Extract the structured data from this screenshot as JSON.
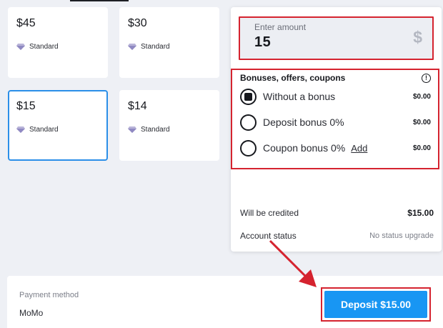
{
  "cards": [
    {
      "amount": "$45",
      "tier": "Standard",
      "selected": false
    },
    {
      "amount": "$30",
      "tier": "Standard",
      "selected": false
    },
    {
      "amount": "$15",
      "tier": "Standard",
      "selected": true
    },
    {
      "amount": "$14",
      "tier": "Standard",
      "selected": false
    }
  ],
  "amount_field": {
    "label": "Enter amount",
    "value": "15",
    "currency": "$"
  },
  "bonuses": {
    "title": "Bonuses, offers, coupons",
    "info": "!",
    "options": [
      {
        "label": "Without a bonus",
        "value": "$0.00",
        "selected": true
      },
      {
        "label": "Deposit bonus 0%",
        "value": "$0.00",
        "selected": false
      },
      {
        "label": "Coupon bonus 0%",
        "link": "Add",
        "value": "$0.00",
        "selected": false
      }
    ]
  },
  "summary": {
    "credited_label": "Will be credited",
    "credited_value": "$15.00",
    "status_label": "Account status",
    "status_value": "No status upgrade"
  },
  "payment": {
    "label": "Payment method",
    "value": "MoMo"
  },
  "deposit_button": "Deposit $15.00",
  "colors": {
    "accent": "#1896f3",
    "highlight": "#d5232f",
    "selected_border": "#2b8fe8"
  }
}
